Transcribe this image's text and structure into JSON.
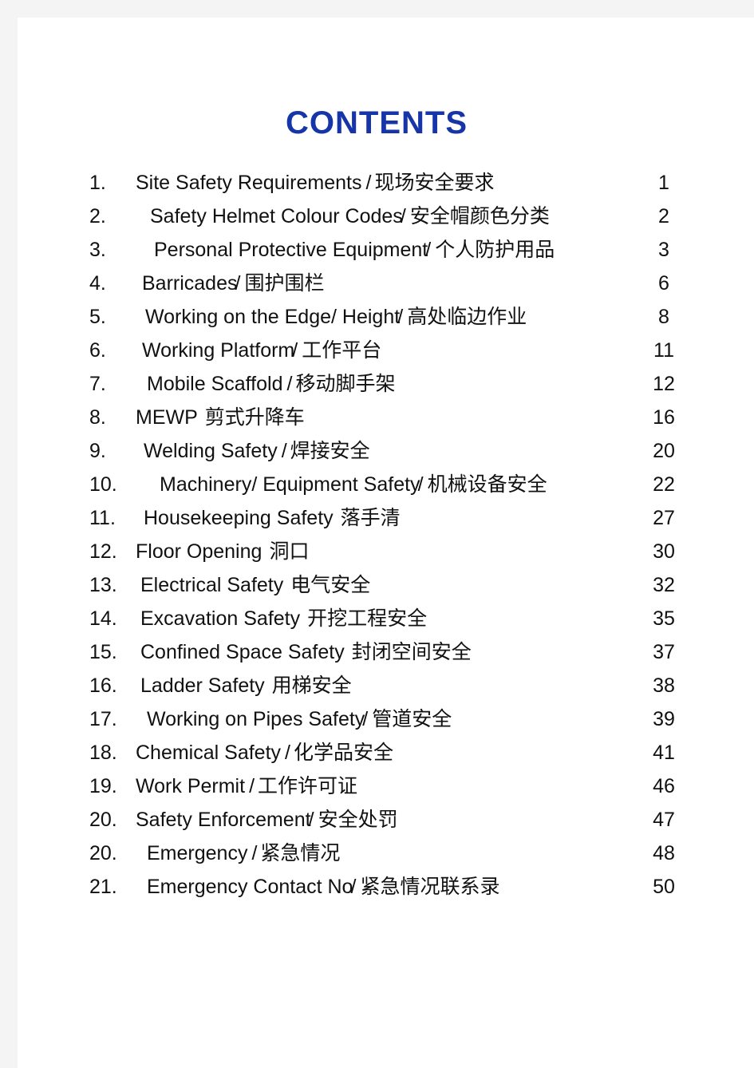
{
  "document": {
    "title": "CONTENTS",
    "title_color": "#1535a8",
    "page_background": "#ffffff",
    "canvas_background": "#f4f4f4",
    "text_color": "#111111"
  },
  "contents": {
    "heading": "CONTENTS",
    "entries": [
      {
        "num": "1.",
        "en": "Site Safety Requirements",
        "sep": "/",
        "zh": "现场安全要求",
        "page": "1",
        "indent": 0,
        "tight": false
      },
      {
        "num": "2.",
        "en": "Safety Helmet Colour Codes",
        "sep": "/",
        "zh": "安全帽颜色分类",
        "page": "2",
        "indent": 1,
        "tight": true
      },
      {
        "num": "3.",
        "en": "Personal Protective Equipment",
        "sep": "/",
        "zh": "个人防护用品",
        "page": "3",
        "indent": 2,
        "tight": true
      },
      {
        "num": "4.",
        "en": "Barricades",
        "sep": "/",
        "zh": "围护围栏",
        "page": "6",
        "indent": 3,
        "tight": true
      },
      {
        "num": "5.",
        "en": "Working on the Edge/ Height",
        "sep": "/",
        "zh": "高处临边作业",
        "page": "8",
        "indent": 4,
        "tight": true
      },
      {
        "num": "6.",
        "en": "Working Platform",
        "sep": "/",
        "zh": "工作平台",
        "page": "11",
        "indent": 3,
        "tight": true
      },
      {
        "num": "7.",
        "en": "Mobile Scaffold",
        "sep": "/",
        "zh": "移动脚手架",
        "page": "12",
        "indent": 5,
        "tight": false
      },
      {
        "num": "8.",
        "en": "MEWP",
        "sep": "",
        "zh": "剪式升降车",
        "page": "16",
        "indent": 0,
        "tight": false
      },
      {
        "num": "9.",
        "en": "Welding Safety",
        "sep": "/",
        "zh": "焊接安全",
        "page": "20",
        "indent": 6,
        "tight": false
      },
      {
        "num": "10.",
        "en": "Machinery/ Equipment Safety",
        "sep": "/",
        "zh": "机械设备安全",
        "page": "22",
        "indent": 7,
        "tight": true
      },
      {
        "num": "11.",
        "en": "Housekeeping Safety",
        "sep": "",
        "zh": "落手清",
        "page": "27",
        "indent": 6,
        "tight": false
      },
      {
        "num": "12.",
        "en": "Floor Opening",
        "sep": "",
        "zh": "洞口",
        "page": "30",
        "indent": 0,
        "tight": false
      },
      {
        "num": "13.",
        "en": "Electrical Safety",
        "sep": "",
        "zh": "电气安全",
        "page": "32",
        "indent": 8,
        "tight": false
      },
      {
        "num": "14.",
        "en": "Excavation Safety",
        "sep": "",
        "zh": "开挖工程安全",
        "page": "35",
        "indent": 8,
        "tight": false
      },
      {
        "num": "15.",
        "en": "Confined Space Safety",
        "sep": "",
        "zh": "封闭空间安全",
        "page": "37",
        "indent": 8,
        "tight": true
      },
      {
        "num": "16.",
        "en": "Ladder Safety",
        "sep": "",
        "zh": "用梯安全",
        "page": "38",
        "indent": 8,
        "tight": false
      },
      {
        "num": "17.",
        "en": "Working on Pipes Safety",
        "sep": "/",
        "zh": "管道安全",
        "page": "39",
        "indent": 5,
        "tight": true
      },
      {
        "num": "18.",
        "en": "Chemical Safety",
        "sep": "/",
        "zh": "化学品安全",
        "page": "41",
        "indent": 0,
        "tight": false
      },
      {
        "num": "19.",
        "en": "Work Permit",
        "sep": "/",
        "zh": "工作许可证",
        "page": "46",
        "indent": 0,
        "tight": false
      },
      {
        "num": "20.",
        "en": "Safety Enforcement",
        "sep": "/",
        "zh": "安全处罚",
        "page": "47",
        "indent": 0,
        "tight": true
      },
      {
        "num": "20.",
        "en": "Emergency",
        "sep": "/",
        "zh": "紧急情况",
        "page": "48",
        "indent": 5,
        "tight": false
      },
      {
        "num": "21.",
        "en": "Emergency Contact No",
        "sep": "/",
        "zh": "紧急情况联系录",
        "page": "50",
        "indent": 5,
        "tight": true
      }
    ]
  }
}
